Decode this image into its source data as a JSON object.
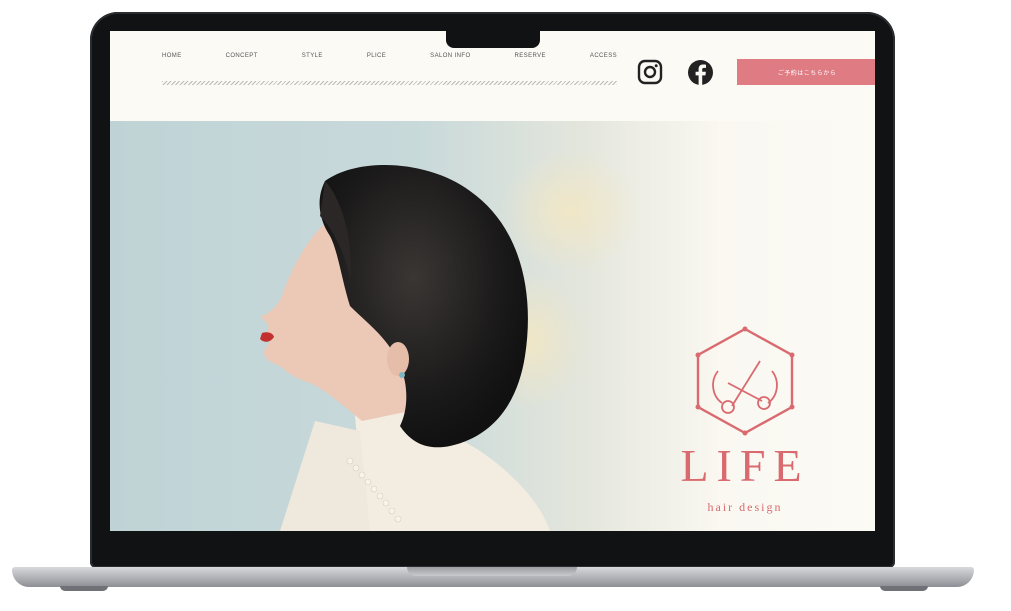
{
  "nav": {
    "items": [
      "HOME",
      "CONCEPT",
      "STYLE",
      "PLICE",
      "SALON INFO",
      "RESERVE",
      "ACCESS"
    ]
  },
  "social": {
    "instagram": "instagram-icon",
    "facebook": "facebook-icon"
  },
  "reserve_button": {
    "label": "ご予約はこちらから"
  },
  "hero": {
    "brand": "LIFE",
    "tagline": "hair design"
  },
  "colors": {
    "accent": "#df7b83",
    "logo": "#d96a6f",
    "hero_bg": "#c4d6d8",
    "page_bg": "#fbfaf5"
  }
}
